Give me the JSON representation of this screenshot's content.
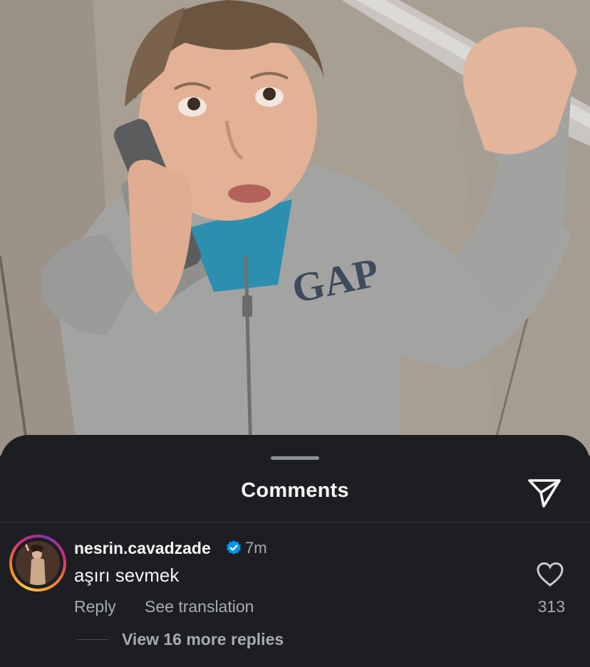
{
  "photo": {
    "description_icon": "photo-image",
    "hoodie_logo": "GAP"
  },
  "sheet": {
    "title": "Comments",
    "share_icon": "send-icon"
  },
  "comment": {
    "username": "nesrin.cavadzade",
    "verified_icon": "verified-badge-icon",
    "time": "7m",
    "text": "aşırı sevmek",
    "reply_label": "Reply",
    "translate_label": "See translation",
    "like_icon": "heart-icon",
    "like_count": "313",
    "view_replies_label": "View 16 more replies"
  },
  "colors": {
    "sheet_bg": "#1c1e21",
    "primary_text": "#f5f5f5",
    "secondary_text": "#a8abaf",
    "verified_blue": "#0095f6"
  }
}
